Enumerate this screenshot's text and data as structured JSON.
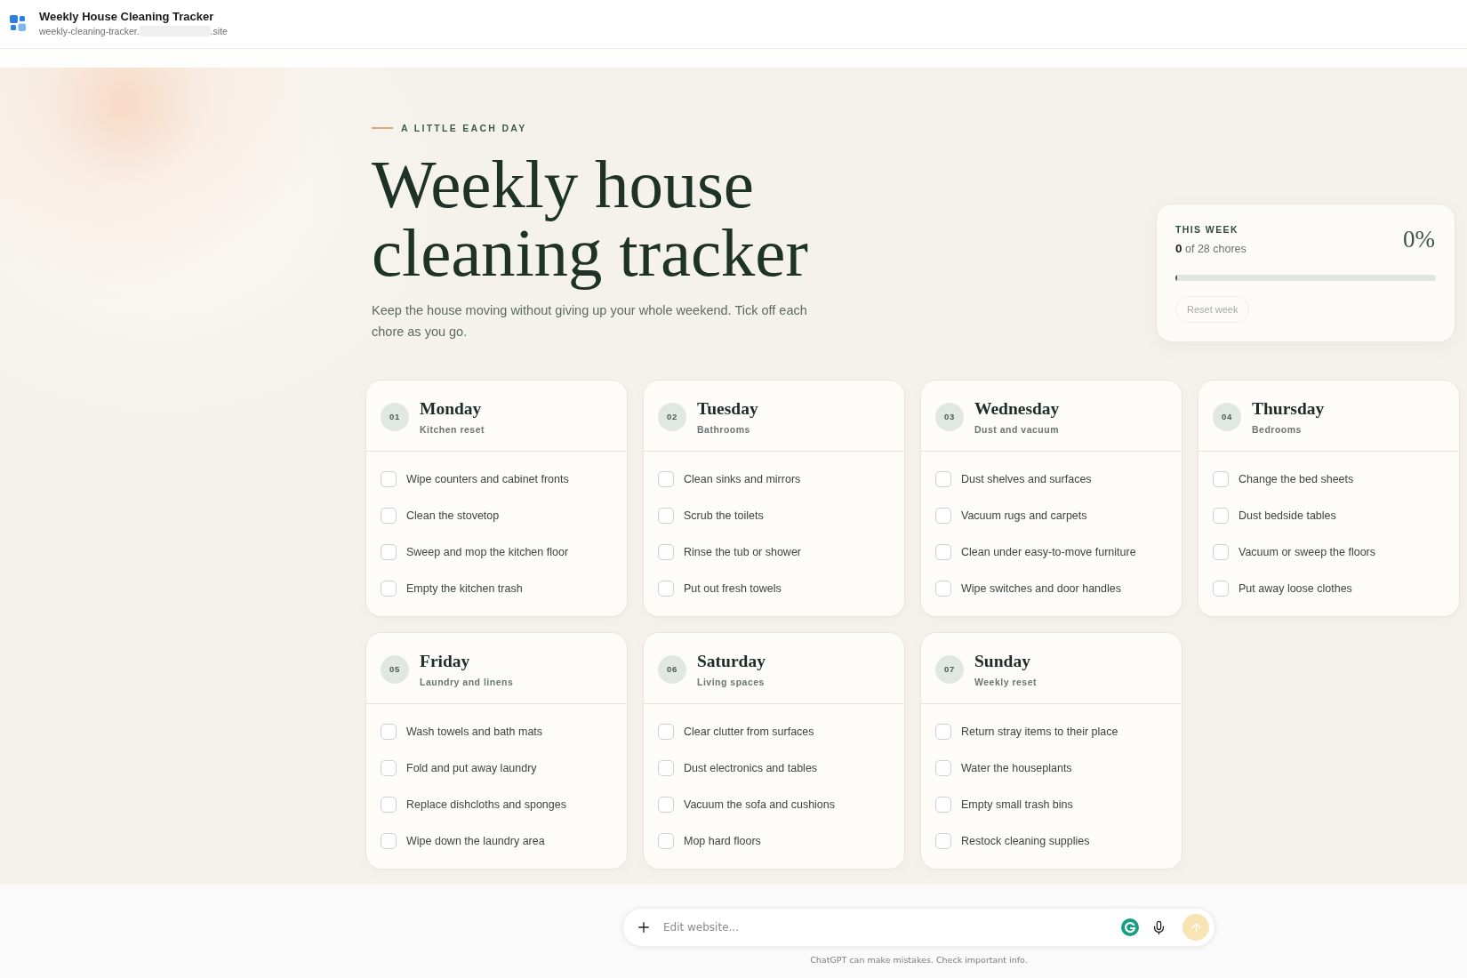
{
  "app_bar": {
    "title": "Weekly House Cleaning Tracker",
    "url_start": "weekly-cleaning-tracker.",
    "url_end": ".site"
  },
  "hero": {
    "kicker": "A LITTLE EACH DAY",
    "title": "Weekly house cleaning tracker",
    "description": "Keep the house moving without giving up your whole weekend. Tick off each chore as you go."
  },
  "progress": {
    "label": "THIS WEEK",
    "summary": "**0** of 28 chores",
    "percent": "0%",
    "level": 0,
    "reset_button": {
      "label": "Reset week",
      "disabled": true
    }
  },
  "days": [
    {
      "number": "01",
      "name": "Monday",
      "focus": "Kitchen reset",
      "chores": [
        {
          "label": "Wipe counters and cabinet fronts",
          "checked": false
        },
        {
          "label": "Clean the stovetop",
          "checked": false
        },
        {
          "label": "Sweep and mop the kitchen floor",
          "checked": false
        },
        {
          "label": "Empty the kitchen trash",
          "checked": false
        }
      ]
    },
    {
      "number": "02",
      "name": "Tuesday",
      "focus": "Bathrooms",
      "chores": [
        {
          "label": "Clean sinks and mirrors",
          "checked": false
        },
        {
          "label": "Scrub the toilets",
          "checked": false
        },
        {
          "label": "Rinse the tub or shower",
          "checked": false
        },
        {
          "label": "Put out fresh towels",
          "checked": false
        }
      ]
    },
    {
      "number": "03",
      "name": "Wednesday",
      "focus": "Dust and vacuum",
      "chores": [
        {
          "label": "Dust shelves and surfaces",
          "checked": false
        },
        {
          "label": "Vacuum rugs and carpets",
          "checked": false
        },
        {
          "label": "Clean under easy-to-move furniture",
          "checked": false
        },
        {
          "label": "Wipe switches and door handles",
          "checked": false
        }
      ]
    },
    {
      "number": "04",
      "name": "Thursday",
      "focus": "Bedrooms",
      "chores": [
        {
          "label": "Change the bed sheets",
          "checked": false
        },
        {
          "label": "Dust bedside tables",
          "checked": false
        },
        {
          "label": "Vacuum or sweep the floors",
          "checked": false
        },
        {
          "label": "Put away loose clothes",
          "checked": false
        }
      ]
    },
    {
      "number": "05",
      "name": "Friday",
      "focus": "Laundry and linens",
      "chores": [
        {
          "label": "Wash towels and bath mats",
          "checked": false
        },
        {
          "label": "Fold and put away laundry",
          "checked": false
        },
        {
          "label": "Replace dishcloths and sponges",
          "checked": false
        },
        {
          "label": "Wipe down the laundry area",
          "checked": false
        }
      ]
    },
    {
      "number": "06",
      "name": "Saturday",
      "focus": "Living spaces",
      "chores": [
        {
          "label": "Clear clutter from surfaces",
          "checked": false
        },
        {
          "label": "Dust electronics and tables",
          "checked": false
        },
        {
          "label": "Vacuum the sofa and cushions",
          "checked": false
        },
        {
          "label": "Mop hard floors",
          "checked": false
        }
      ]
    },
    {
      "number": "07",
      "name": "Sunday",
      "focus": "Weekly reset",
      "chores": [
        {
          "label": "Return stray items to their place",
          "checked": false
        },
        {
          "label": "Water the houseplants",
          "checked": false
        },
        {
          "label": "Empty small trash bins",
          "checked": false
        },
        {
          "label": "Restock cleaning supplies",
          "checked": false
        }
      ]
    }
  ],
  "composer": {
    "placeholder": "Edit website...",
    "disclaimer": "ChatGPT can make mistakes. Check important info."
  }
}
